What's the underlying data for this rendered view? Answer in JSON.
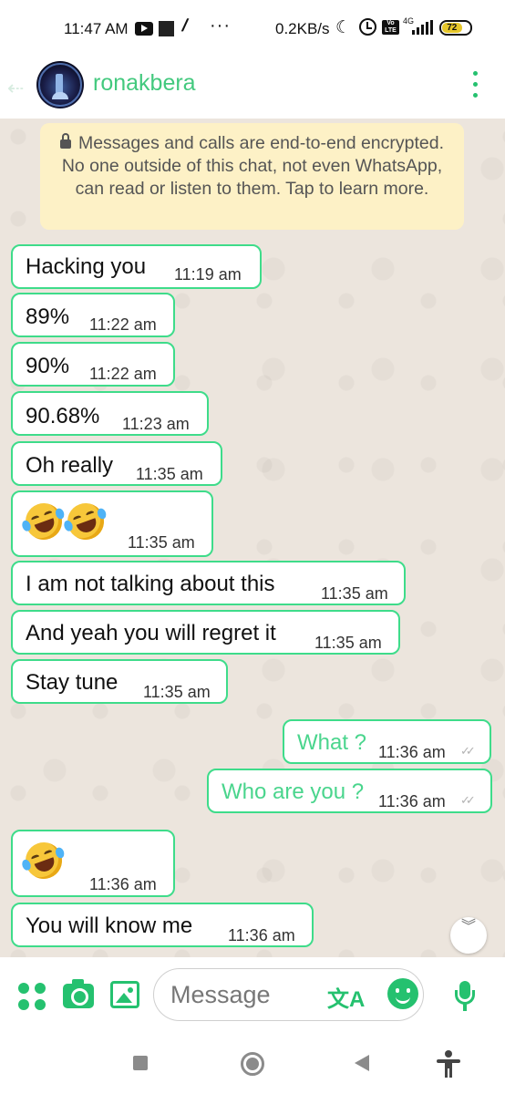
{
  "status_bar": {
    "time": "11:47 AM",
    "network_speed": "0.2KB/s",
    "battery_level": "72",
    "network_type": "4G",
    "volte_label": "Vo LTE",
    "icons": [
      "youtube-icon",
      "square-notification-icon",
      "slash-notification-icon",
      "more-notifications-icon",
      "moon-icon",
      "alarm-icon",
      "volte-icon",
      "signal-icon",
      "battery-icon"
    ]
  },
  "header": {
    "contact_name": "ronakbera",
    "icons": [
      "back-arrow-icon",
      "avatar",
      "more-options-icon"
    ]
  },
  "chat": {
    "encryption_notice": "Messages and calls are end-to-end encrypted. No one outside of this chat, not even WhatsApp, can read or listen to them. Tap to learn more.",
    "messages": [
      {
        "direction": "in",
        "text": "Hacking you",
        "time": "11:19 am"
      },
      {
        "direction": "in",
        "text": "89%",
        "time": "11:22 am"
      },
      {
        "direction": "in",
        "text": "90%",
        "time": "11:22 am"
      },
      {
        "direction": "in",
        "text": "90.68%",
        "time": "11:23 am"
      },
      {
        "direction": "in",
        "text": "Oh really",
        "time": "11:35 am"
      },
      {
        "direction": "in",
        "emoji": [
          "rofl-emoji",
          "rofl-emoji"
        ],
        "time": "11:35 am"
      },
      {
        "direction": "in",
        "text": "I am not talking about this",
        "time": "11:35 am"
      },
      {
        "direction": "in",
        "text": "And yeah you will regret it",
        "time": "11:35 am"
      },
      {
        "direction": "in",
        "text": "Stay tune",
        "time": "11:35 am"
      },
      {
        "direction": "out",
        "text": "What ?",
        "time": "11:36 am",
        "status": "read"
      },
      {
        "direction": "out",
        "text": "Who are you ?",
        "time": "11:36 am",
        "status": "read"
      },
      {
        "direction": "in",
        "emoji": [
          "rofl-emoji"
        ],
        "time": "11:36 am"
      },
      {
        "direction": "in",
        "text": "You will know me",
        "time": "11:36 am"
      }
    ]
  },
  "input_bar": {
    "placeholder": "Message",
    "icons": [
      "apps-icon",
      "camera-icon",
      "gallery-icon",
      "translate-icon",
      "emoji-icon",
      "mic-icon"
    ],
    "translate_glyph": "文A"
  },
  "nav_bar": {
    "icons": [
      "recents-icon",
      "home-icon",
      "back-icon",
      "accessibility-icon"
    ]
  },
  "colors": {
    "accent": "#25c16f",
    "bubble_border": "#3edc8a",
    "chat_background": "#ece5dd",
    "encryption_background": "#fdf1c6"
  }
}
